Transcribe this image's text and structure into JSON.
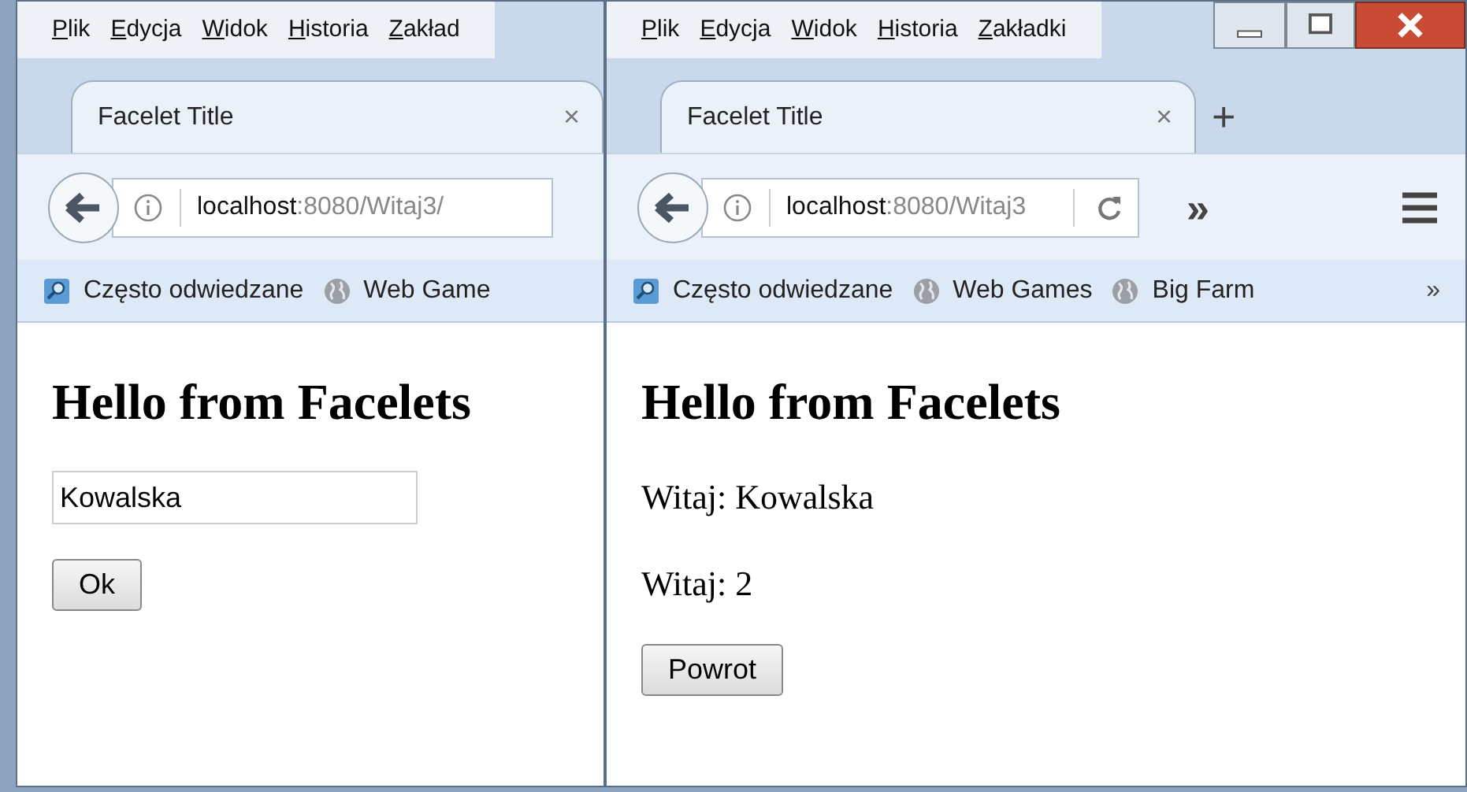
{
  "windows": [
    {
      "menu": [
        "Plik",
        "Edycja",
        "Widok",
        "Historia",
        "Zakład"
      ],
      "tab": {
        "title": "Facelet Title",
        "close": "×"
      },
      "url": {
        "host": "localhost",
        "path": ":8080/Witaj3/"
      },
      "bookmarks": [
        "Często odwiedzane",
        "Web Game"
      ],
      "page": {
        "heading": "Hello from Facelets",
        "blocks": [
          {
            "kind": "input",
            "value": "Kowalska"
          },
          {
            "kind": "button",
            "label": "Ok"
          }
        ]
      }
    },
    {
      "menu": [
        "Plik",
        "Edycja",
        "Widok",
        "Historia",
        "Zakładki"
      ],
      "window_controls": true,
      "tab": {
        "title": "Facelet Title",
        "close": "×"
      },
      "new_tab": "+",
      "url": {
        "host": "localhost",
        "path": ":8080/Witaj3"
      },
      "reload": true,
      "toolbar_overflow": "»",
      "hamburger": true,
      "bookmarks": [
        "Często odwiedzane",
        "Web Games",
        "Big Farm"
      ],
      "bookmarks_overflow": "»",
      "page": {
        "heading": "Hello from Facelets",
        "blocks": [
          {
            "kind": "text",
            "text": "Witaj: Kowalska"
          },
          {
            "kind": "text",
            "text": "Witaj: 2"
          },
          {
            "kind": "button",
            "label": "Powrot"
          }
        ]
      }
    }
  ]
}
